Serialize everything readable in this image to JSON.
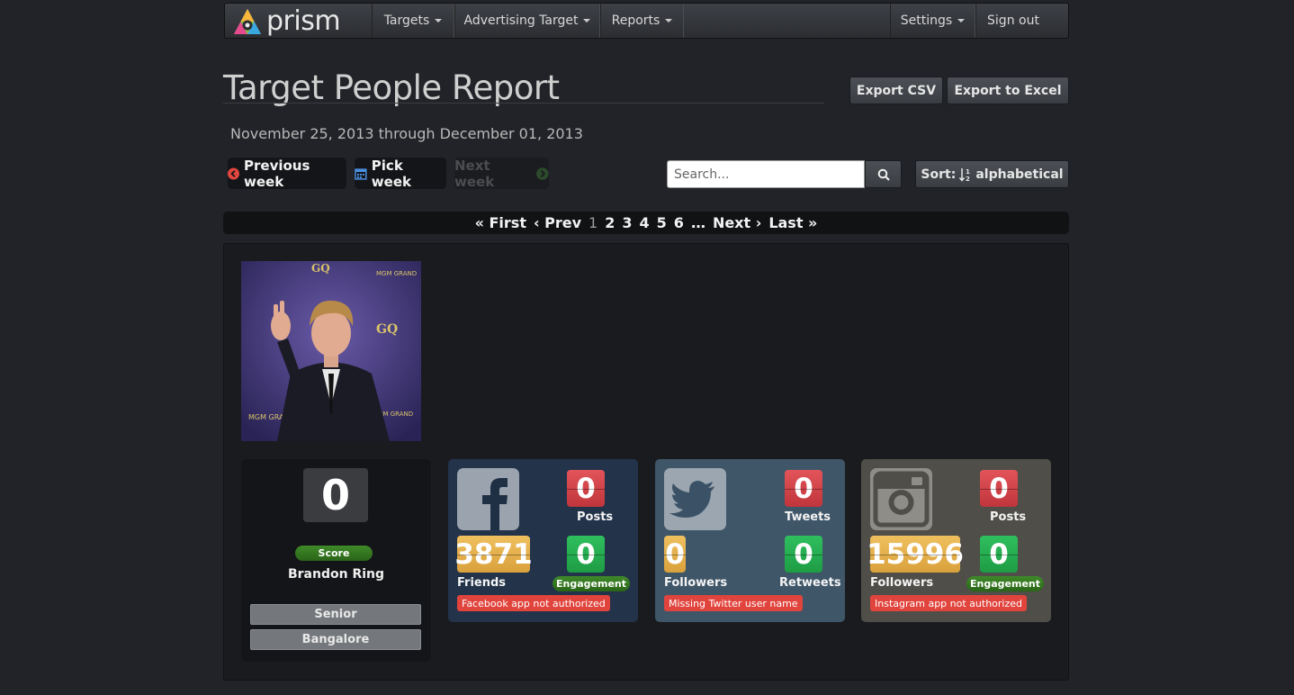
{
  "nav": {
    "brand": "prism",
    "items": [
      {
        "label": "Targets",
        "dropdown": true
      },
      {
        "label": "Advertising Target",
        "dropdown": true
      },
      {
        "label": "Reports",
        "dropdown": true
      }
    ],
    "right_items": [
      {
        "label": "Settings",
        "dropdown": true
      },
      {
        "label": "Sign out",
        "dropdown": false
      }
    ]
  },
  "header": {
    "title": "Target People Report",
    "export_csv": "Export CSV",
    "export_excel": "Export to Excel",
    "date_range": "November 25, 2013 through December 01, 2013"
  },
  "week_nav": {
    "previous": "Previous week",
    "pick": "Pick week",
    "next": "Next week"
  },
  "search": {
    "placeholder": "Search...",
    "sort_label": "Sort:",
    "sort_value": "alphabetical"
  },
  "pagination": {
    "first": "« First",
    "prev": "‹ Prev",
    "pages": [
      "1",
      "2",
      "3",
      "4",
      "5",
      "6"
    ],
    "current_page": "1",
    "ellipsis": "…",
    "next": "Next ›",
    "last": "Last »"
  },
  "person": {
    "score": "0",
    "score_label": "Score",
    "name": "Brandon Ring",
    "tags": [
      "Senior",
      "Bangalore"
    ]
  },
  "facebook": {
    "color": "#23334a",
    "posts": "0",
    "posts_label": "Posts",
    "friends": "3871",
    "friends_label": "Friends",
    "engagement": "0",
    "engagement_label": "Engagement",
    "warning": "Facebook app not authorized"
  },
  "twitter": {
    "color": "#3f5668",
    "tweets": "0",
    "tweets_label": "Tweets",
    "followers": "0",
    "followers_label": "Followers",
    "retweets": "0",
    "retweets_label": "Retweets",
    "warning": "Missing Twitter user name"
  },
  "instagram": {
    "color": "#4f4e48",
    "posts": "0",
    "posts_label": "Posts",
    "followers": "15996",
    "followers_label": "Followers",
    "engagement": "0",
    "engagement_label": "Engagement",
    "warning": "Instagram app not authorized"
  }
}
